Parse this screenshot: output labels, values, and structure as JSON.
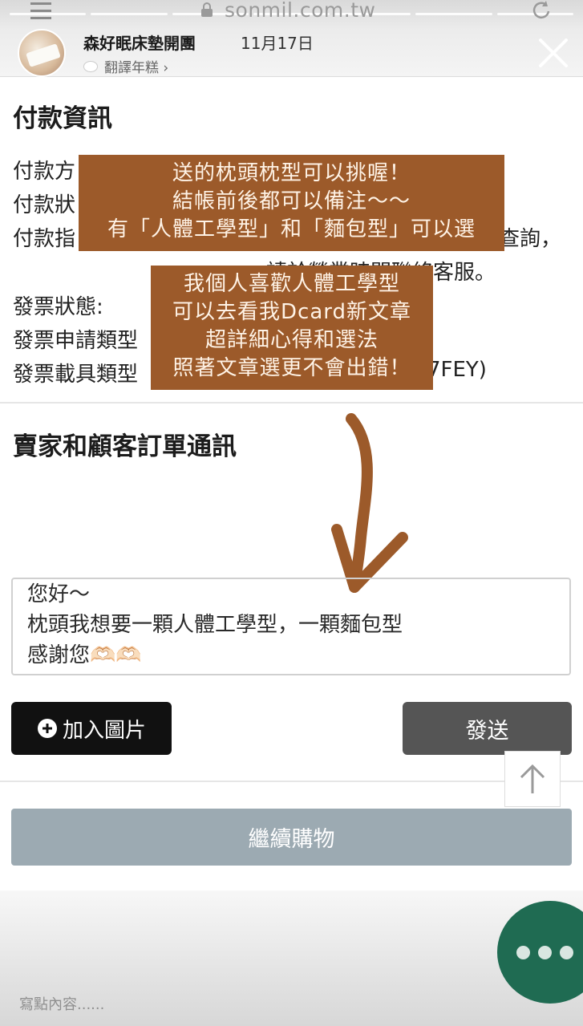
{
  "story": {
    "url": "sonmil.com.tw",
    "account_name": "森好眠床墊開團",
    "date": "11月17日",
    "translate_label": "翻譯年糕 ›",
    "progress_segments": 7
  },
  "payment": {
    "title": "付款資訊",
    "lines": [
      "付款方",
      "付款狀",
      "付款指",
      "查詢，",
      "請於營業時間聯絡客服。"
    ],
    "invoice_status": "發票狀態:",
    "invoice_apply_type": "發票申請類型",
    "invoice_carrier_type": "發票載具類型",
    "carrier_suffix": "7FEY)"
  },
  "stickers": {
    "first": [
      "送的枕頭枕型可以挑喔！",
      "結帳前後都可以備注～～",
      "有「人體工學型」和「麵包型」可以選"
    ],
    "second": [
      "我個人喜歡人體工學型",
      "可以去看我Dcard新文章",
      "超詳細心得和選法",
      "照著文章選更不會出錯！"
    ]
  },
  "messages": {
    "title": "賣家和顧客訂單通訊",
    "message_lines": [
      "您好～",
      "枕頭我想要一顆人體工學型，一顆麵包型",
      "感謝您🫶🏻🫶🏻"
    ],
    "add_image_label": "加入圖片",
    "send_label": "發送"
  },
  "continue_label": "繼續購物",
  "reply_placeholder": "寫點內容......",
  "colors": {
    "sticker_bg": "#9c5a2a",
    "arrow": "#9c5a2a",
    "continue_bg": "#9caab2",
    "send_bg": "#555555",
    "chat_fab": "#1f6b52"
  },
  "icons": [
    "menu-icon",
    "lock-icon",
    "reload-icon",
    "close-icon",
    "plus-circle-icon",
    "arrow-up-icon",
    "chat-dots-icon"
  ]
}
